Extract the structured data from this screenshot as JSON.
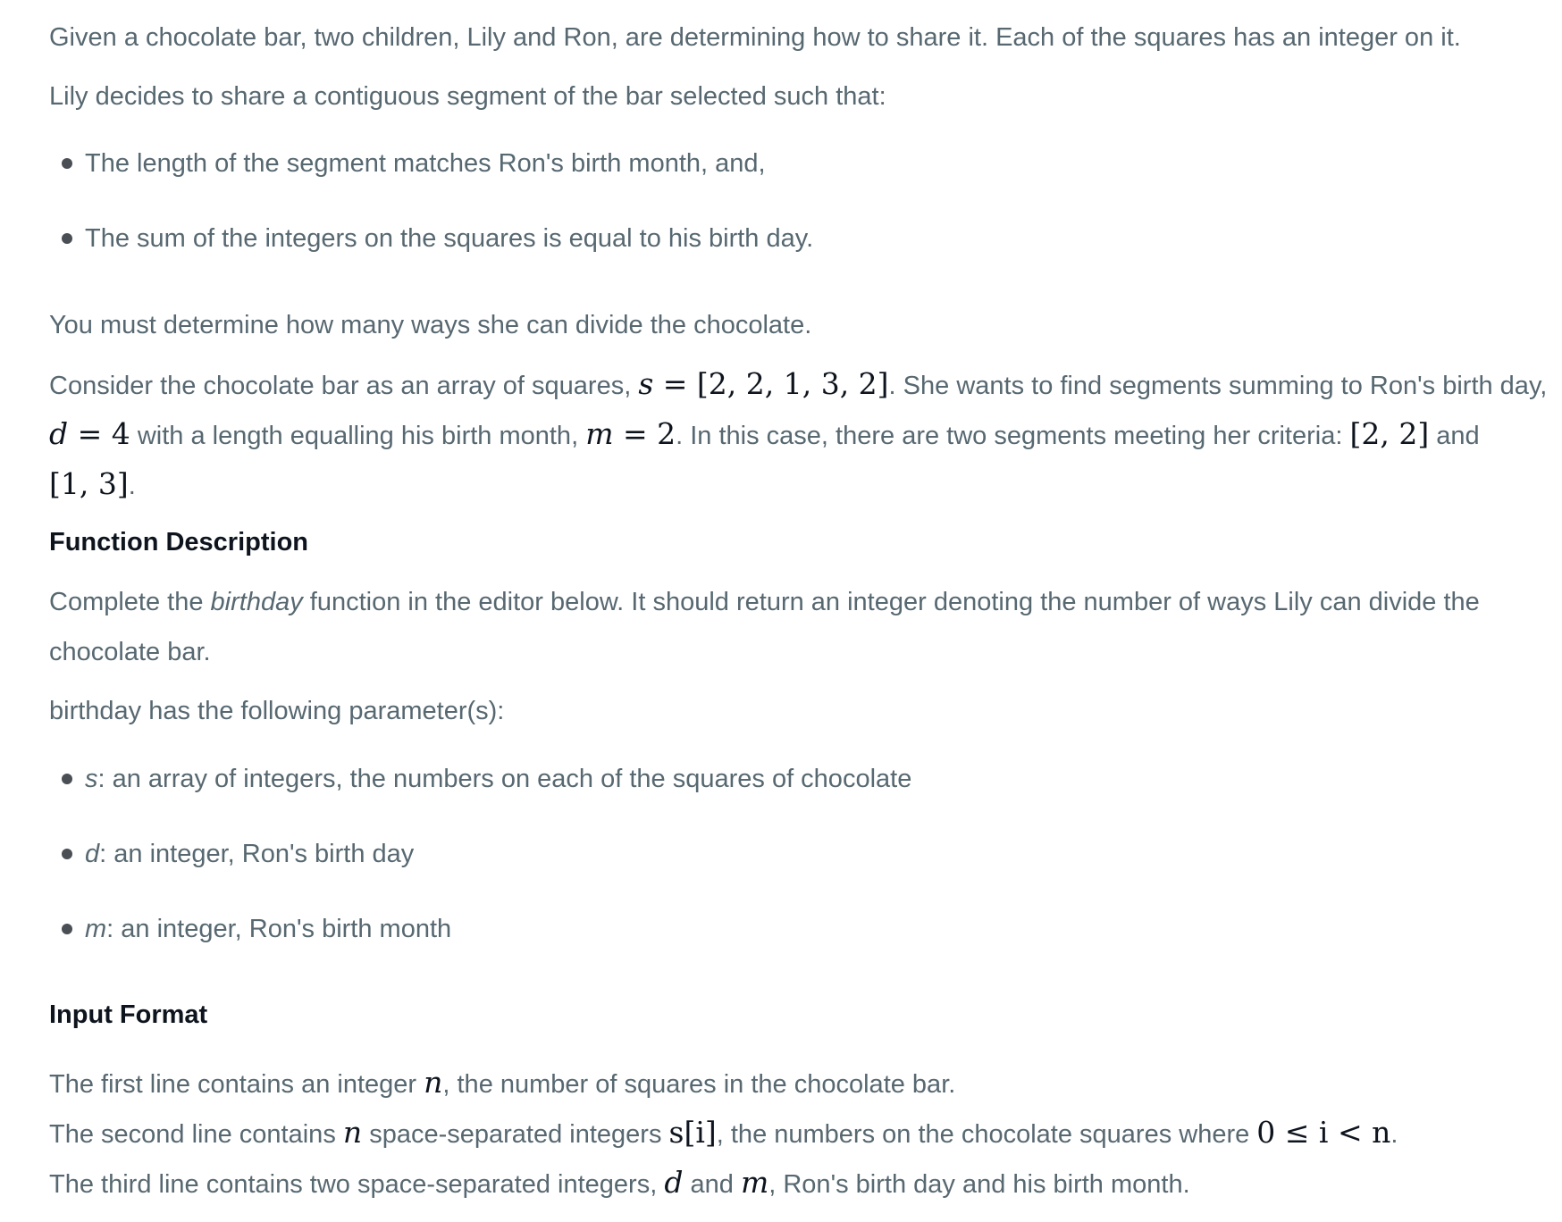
{
  "intro": {
    "p1": "Given a chocolate bar, two children, Lily and Ron, are determining how to share it. Each of the squares has an integer on it.",
    "p2": "Lily decides to share a contiguous segment of the bar selected such that:",
    "criteria": [
      "The length of the segment matches Ron's birth month, and,",
      "The sum of the integers on the squares is equal to his birth day."
    ],
    "p3": "You must determine how many ways she can divide the chocolate."
  },
  "example": {
    "t1": "Consider the chocolate bar as an array of squares,",
    "m_s": "s",
    "m_eq1": " = [2, 2, 1, 3, 2]",
    "t2": ". She wants to find segments summing to Ron's birth day,",
    "m_d": "d",
    "m_eq2": " = 4",
    "t3": " with a length equalling his birth month,",
    "m_m": "m",
    "m_eq3": " = 2",
    "t4": ". In this case, there are two segments meeting her criteria:",
    "m_seg1": "[2, 2]",
    "t5": " and",
    "m_seg2": "[1, 3]",
    "t6": "."
  },
  "function_description": {
    "heading": "Function Description",
    "p_a": "Complete the ",
    "p_fn": "birthday",
    "p_b": " function in the editor below. It should return an integer denoting the number of ways Lily can divide the chocolate bar.",
    "params_intro": "birthday has the following parameter(s):",
    "params": [
      {
        "name": "s",
        "desc": ": an array of integers, the numbers on each of the squares of chocolate"
      },
      {
        "name": "d",
        "desc": ": an integer, Ron's birth day"
      },
      {
        "name": "m",
        "desc": ": an integer, Ron's birth month"
      }
    ]
  },
  "input_format": {
    "heading": "Input Format",
    "l1a": "The first line contains an integer ",
    "l1_n": "n",
    "l1b": ", the number of squares in the chocolate bar.",
    "l2a": "The second line contains ",
    "l2_n": "n",
    "l2b": " space-separated integers ",
    "l2_si": "s[i]",
    "l2c": ", the numbers on the chocolate squares where ",
    "l2_cond": "0 ≤ i < n",
    "l2d": ".",
    "l3a": "The third line contains two space-separated integers, ",
    "l3_d": "d",
    "l3b": " and ",
    "l3_m": "m",
    "l3c": ", Ron's birth day and his birth month."
  }
}
